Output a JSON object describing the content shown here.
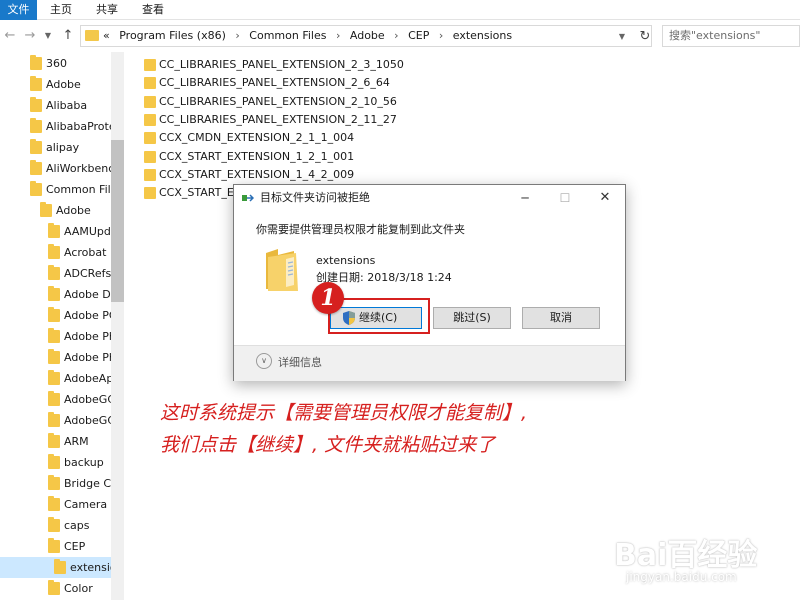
{
  "ribbon": {
    "tabs": [
      "文件",
      "主页",
      "共享",
      "查看"
    ]
  },
  "address": {
    "overflow": "«",
    "segments": [
      "Program Files (x86)",
      "Common Files",
      "Adobe",
      "CEP",
      "extensions"
    ],
    "separator": "›"
  },
  "search": {
    "placeholder": "搜索\"extensions\""
  },
  "sidebar": {
    "items": [
      {
        "label": "360"
      },
      {
        "label": "Adobe"
      },
      {
        "label": "Alibaba"
      },
      {
        "label": "AlibabaProte"
      },
      {
        "label": "alipay"
      },
      {
        "label": "AliWorkbenc"
      },
      {
        "label": "Common Fil"
      },
      {
        "label": "Adobe"
      },
      {
        "label": "AAMUpd"
      },
      {
        "label": "Acrobat"
      },
      {
        "label": "ADCRefs"
      },
      {
        "label": "Adobe De"
      },
      {
        "label": "Adobe PC"
      },
      {
        "label": "Adobe Ph"
      },
      {
        "label": "Adobe Ph"
      },
      {
        "label": "AdobeAp"
      },
      {
        "label": "AdobeGC"
      },
      {
        "label": "AdobeGC"
      },
      {
        "label": "ARM"
      },
      {
        "label": "backup"
      },
      {
        "label": "Bridge CC"
      },
      {
        "label": "Camera R"
      },
      {
        "label": "caps"
      },
      {
        "label": "CEP"
      },
      {
        "label": "extensio"
      },
      {
        "label": "Color"
      }
    ]
  },
  "files": [
    "CC_LIBRARIES_PANEL_EXTENSION_2_3_1050",
    "CC_LIBRARIES_PANEL_EXTENSION_2_6_64",
    "CC_LIBRARIES_PANEL_EXTENSION_2_10_56",
    "CC_LIBRARIES_PANEL_EXTENSION_2_11_27",
    "CCX_CMDN_EXTENSION_2_1_1_004",
    "CCX_START_EXTENSION_1_2_1_001",
    "CCX_START_EXTENSION_1_4_2_009",
    "CCX_START_EX"
  ],
  "dialog": {
    "title": "目标文件夹访问被拒绝",
    "message": "你需要提供管理员权限才能复制到此文件夹",
    "folder_name": "extensions",
    "created": "创建日期: 2018/3/18 1:24",
    "btn_continue": "继续(C)",
    "btn_skip": "跳过(S)",
    "btn_cancel": "取消",
    "more_info": "详细信息",
    "step": "1"
  },
  "annotation": {
    "line1": "这时系统提示【需要管理员权限才能复制】,",
    "line2": "我们点击【继续】, 文件夹就粘贴过来了"
  },
  "watermark": {
    "logo": "Bai百经验",
    "url": "jingyan.baidu.com"
  },
  "colors": {
    "accent": "#1979ca",
    "annotation": "#d6201f",
    "folder": "#f5c747"
  }
}
